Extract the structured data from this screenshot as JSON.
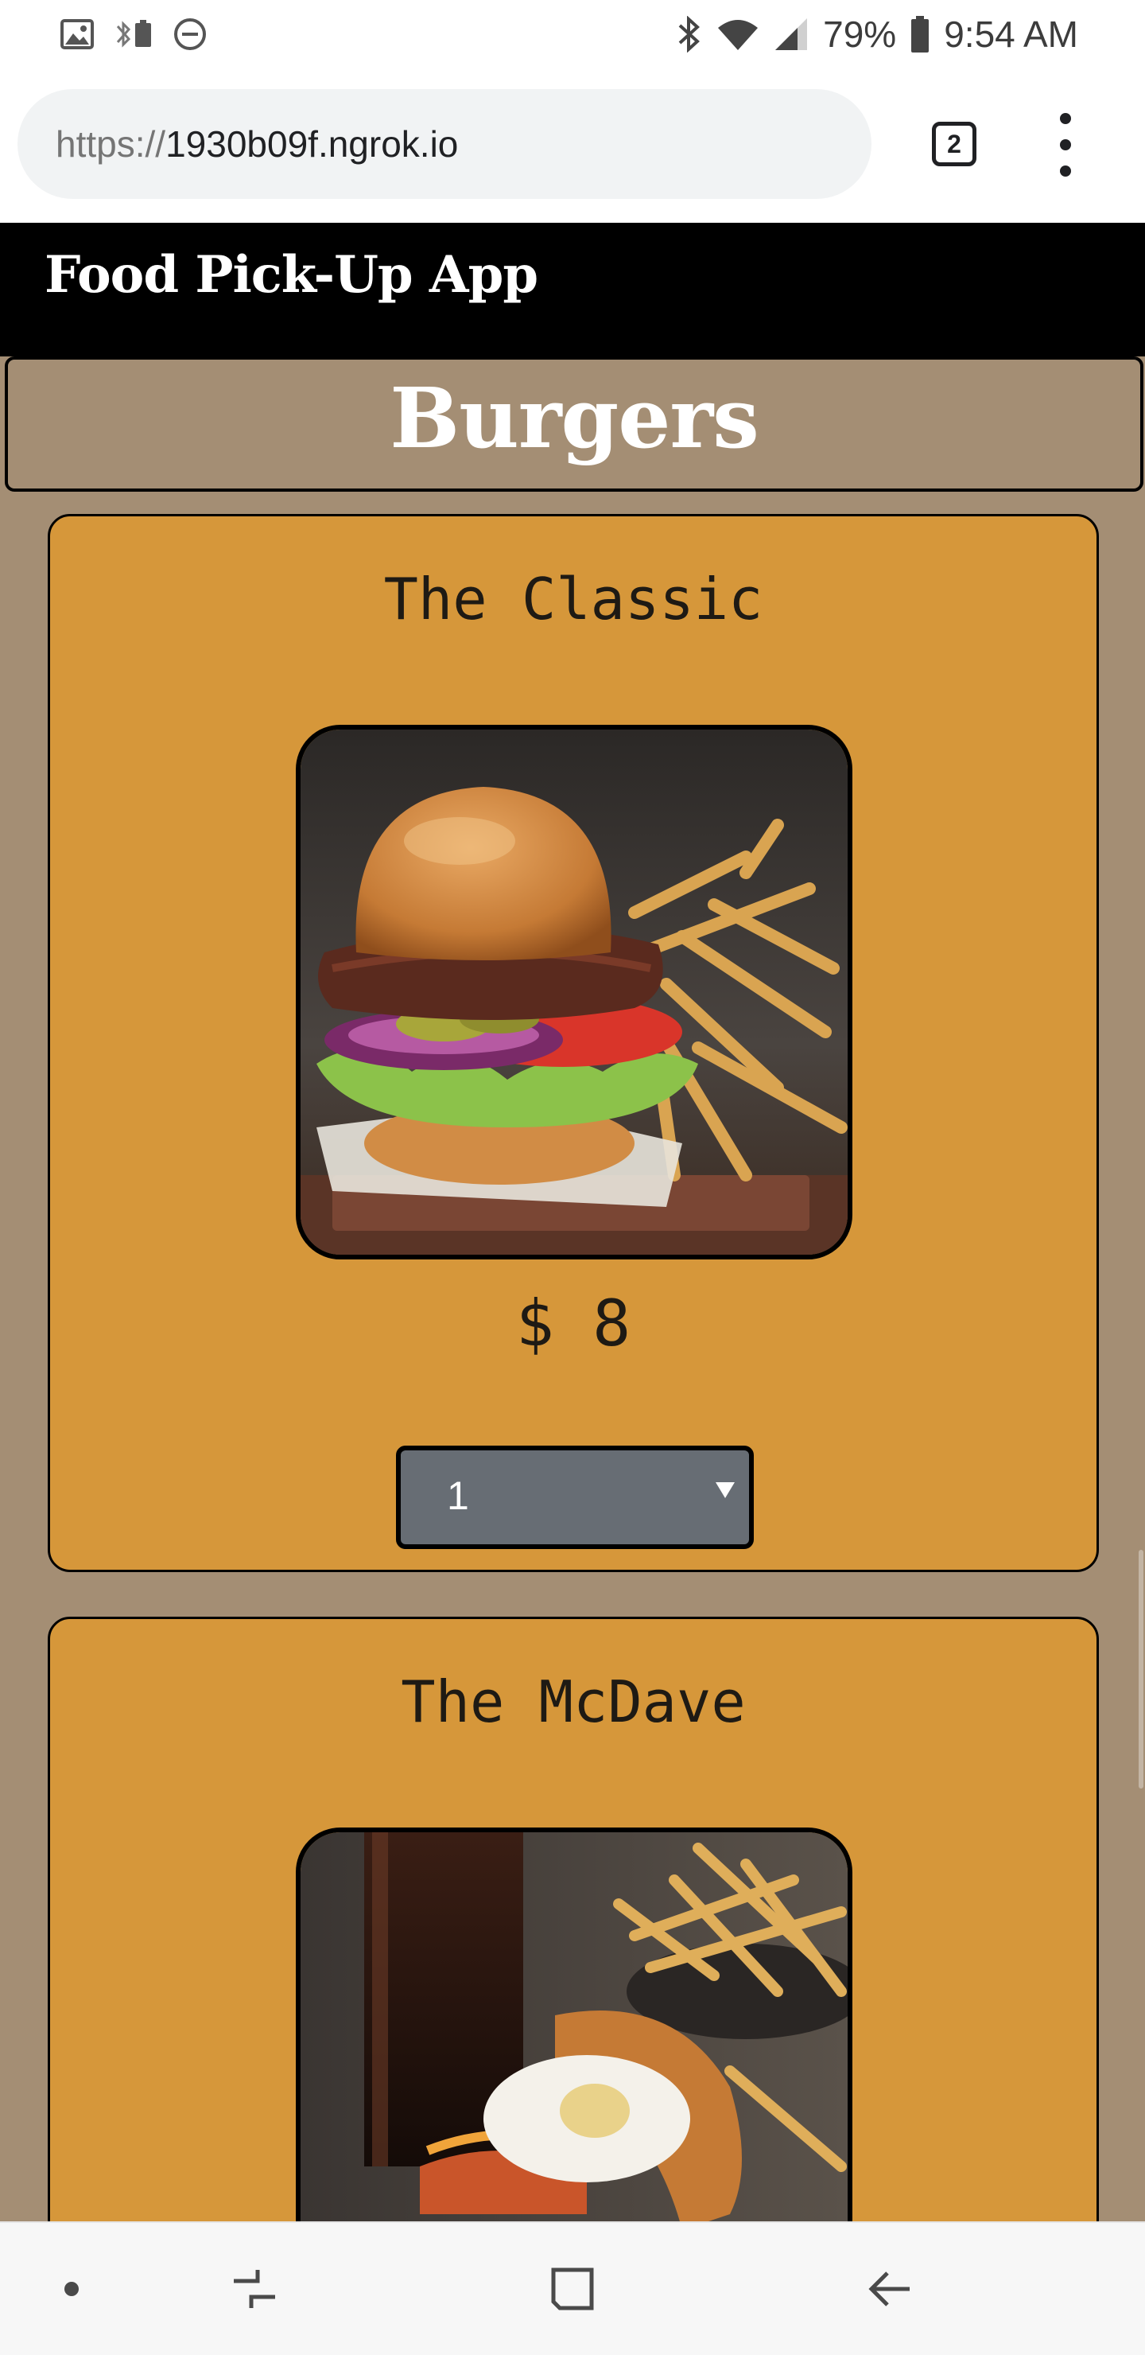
{
  "status_bar": {
    "battery": "79%",
    "time": "9:54 AM",
    "icons_left": [
      "gallery-icon",
      "bluetooth-battery-icon",
      "do-not-disturb-icon"
    ],
    "icons_right": [
      "bluetooth-icon",
      "wifi-icon",
      "signal-icon",
      "battery-icon"
    ]
  },
  "browser": {
    "url_scheme": "https://",
    "url_host": "1930b09f.ngrok.io",
    "tab_count": "2",
    "menu_icon": "more-vert-icon"
  },
  "app": {
    "title": "Food Pick-Up App"
  },
  "category": {
    "title": "Burgers"
  },
  "items": [
    {
      "name": "The Classic",
      "price": "$ 8",
      "quantity": "1",
      "image_icon": "burger-with-fries-photo"
    },
    {
      "name": "The McDave",
      "image_icon": "burger-with-egg-and-fries-photo"
    }
  ],
  "nav_bar": {
    "icons": [
      "nav-dot-icon",
      "recents-icon",
      "home-icon",
      "back-icon"
    ]
  },
  "colors": {
    "header_bg": "#000000",
    "page_bg": "#a48e74",
    "card_bg": "#d6973a",
    "select_bg": "#676d74"
  }
}
